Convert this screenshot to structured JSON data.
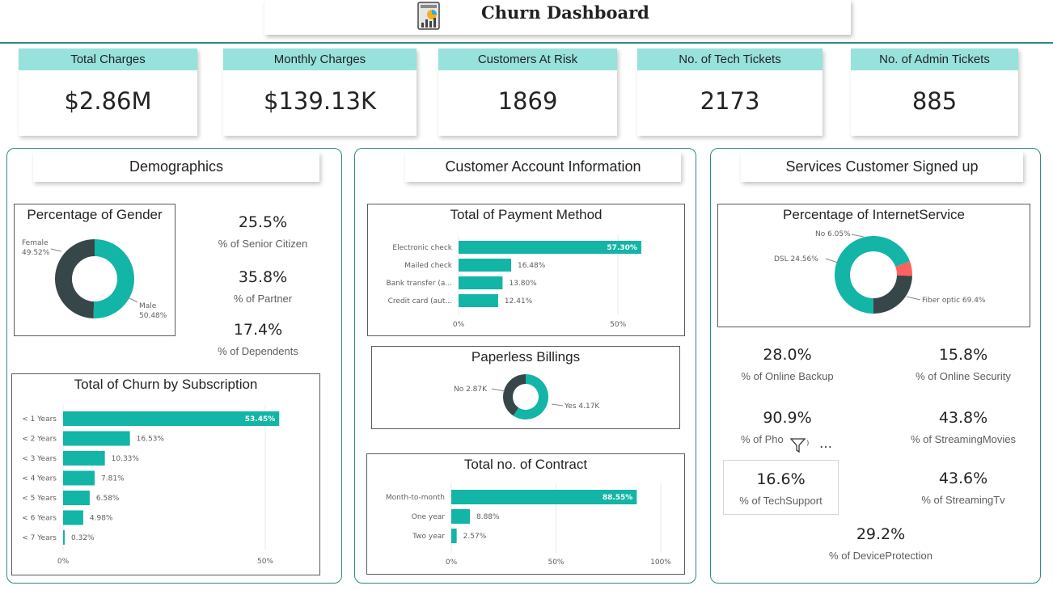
{
  "header": {
    "title": "Churn Dashboard",
    "icon": "dashboard-report-icon"
  },
  "kpis": [
    {
      "label": "Total Charges",
      "value": "$2.86M"
    },
    {
      "label": "Monthly Charges",
      "value": "$139.13K"
    },
    {
      "label": "Customers At Risk",
      "value": "1869"
    },
    {
      "label": "No. of Tech Tickets",
      "value": "2173"
    },
    {
      "label": "No. of Admin Tickets",
      "value": "885"
    }
  ],
  "sections": {
    "demographics": "Demographics",
    "account": "Customer Account Information",
    "services": "Services Customer Signed up"
  },
  "demographics": {
    "stats": [
      {
        "value": "25.5%",
        "label": "% of Senior Citizen"
      },
      {
        "value": "35.8%",
        "label": "% of Partner"
      },
      {
        "value": "17.4%",
        "label": "% of Dependents"
      }
    ]
  },
  "services": {
    "stats": [
      {
        "value": "28.0%",
        "label": "% of Online Backup"
      },
      {
        "value": "15.8%",
        "label": "% of Online Security"
      },
      {
        "value": "90.9%",
        "label": "% of Pho"
      },
      {
        "value": "43.8%",
        "label": "% of StreamingMovies"
      },
      {
        "value": "16.6%",
        "label": "% of TechSupport"
      },
      {
        "value": "43.6%",
        "label": "% of StreamingTv"
      },
      {
        "value": "29.2%",
        "label": "% of DeviceProtection"
      }
    ]
  },
  "colors": {
    "teal": "#12b5a6",
    "dark": "#374649",
    "red": "#fd625e",
    "header_teal": "#97e2dc",
    "border": "#2a8a86"
  },
  "chart_data": [
    {
      "id": "gender",
      "type": "pie",
      "title": "Percentage of Gender",
      "categories": [
        "Male",
        "Female"
      ],
      "values": [
        50.48,
        49.52
      ],
      "labels": [
        "Male\n50.48%",
        "Female\n49.52%"
      ]
    },
    {
      "id": "churn_subscription",
      "type": "bar",
      "title": "Total of Churn by Subscription",
      "categories": [
        "< 1 Years",
        "< 2 Years",
        "< 3 Years",
        "< 4 Years",
        "< 5 Years",
        "< 6 Years",
        "< 7 Years"
      ],
      "values": [
        53.45,
        16.53,
        10.33,
        7.81,
        6.58,
        4.98,
        0.32
      ],
      "value_labels": [
        "53.45%",
        "16.53%",
        "10.33%",
        "7.81%",
        "6.58%",
        "4.98%",
        "0.32%"
      ],
      "xticks": [
        "0%",
        "50%"
      ],
      "xlim": [
        0,
        60
      ]
    },
    {
      "id": "payment_method",
      "type": "bar",
      "title": "Total of Payment Method",
      "categories": [
        "Electronic check",
        "Mailed check",
        "Bank transfer (a...",
        "Credit card (aut..."
      ],
      "values": [
        57.3,
        16.48,
        13.8,
        12.41
      ],
      "value_labels": [
        "57.30%",
        "16.48%",
        "13.80%",
        "12.41%"
      ],
      "xticks": [
        "0%",
        "50%"
      ],
      "xlim": [
        0,
        70
      ]
    },
    {
      "id": "paperless",
      "type": "pie",
      "title": "Paperless Billings",
      "categories": [
        "Yes",
        "No"
      ],
      "values": [
        4.17,
        2.87
      ],
      "labels": [
        "Yes 4.17K",
        "No 2.87K"
      ]
    },
    {
      "id": "contract",
      "type": "bar",
      "title": "Total no. of Contract",
      "categories": [
        "Month-to-month",
        "One year",
        "Two year"
      ],
      "values": [
        88.55,
        8.88,
        2.57
      ],
      "value_labels": [
        "88.55%",
        "8.88%",
        "2.57%"
      ],
      "xticks": [
        "0%",
        "50%",
        "100%"
      ],
      "xlim": [
        0,
        100
      ]
    },
    {
      "id": "internet",
      "type": "pie",
      "title": "Percentage of InternetService",
      "categories": [
        "Fiber optic",
        "No",
        "DSL"
      ],
      "values": [
        69.4,
        6.05,
        24.56
      ],
      "labels": [
        "Fiber optic 69.4%",
        "No 6.05%",
        "DSL 24.56%"
      ]
    }
  ]
}
